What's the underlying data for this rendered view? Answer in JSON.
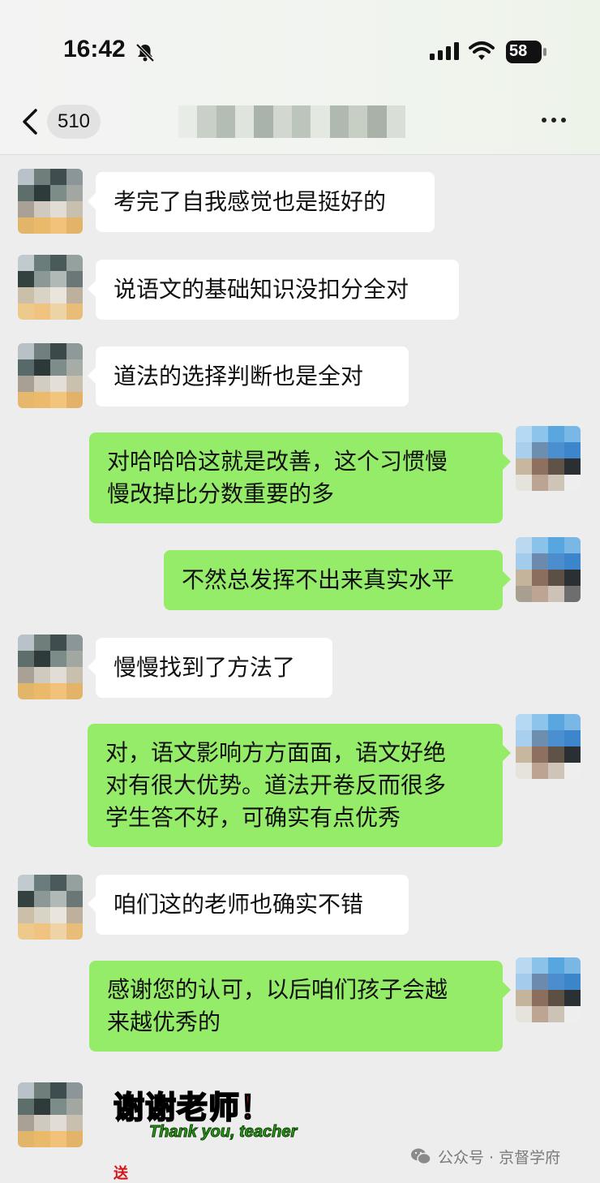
{
  "status": {
    "time": "16:42",
    "battery": "58"
  },
  "nav": {
    "unread": "510"
  },
  "messages": [
    {
      "side": "left",
      "lines": [
        "考完了自我感觉也是挺好的"
      ]
    },
    {
      "side": "left",
      "lines": [
        "说语文的基础知识没扣分全对"
      ]
    },
    {
      "side": "left",
      "lines": [
        "道法的选择判断也是全对"
      ]
    },
    {
      "side": "right",
      "lines": [
        "对哈哈哈这就是改善，这个习惯慢",
        "慢改掉比分数重要的多"
      ]
    },
    {
      "side": "right",
      "lines": [
        "不然总发挥不出来真实水平"
      ]
    },
    {
      "side": "left",
      "lines": [
        "慢慢找到了方法了"
      ]
    },
    {
      "side": "right",
      "lines": [
        "对，语文影响方方面面，语文好绝",
        "对有很大优势。道法开卷反而很多",
        "学生答不好，可确实有点优秀"
      ]
    },
    {
      "side": "left",
      "lines": [
        "咱们这的老师也确实不错"
      ]
    },
    {
      "side": "right",
      "lines": [
        "感谢您的认可，以后咱们孩子会越",
        "来越优秀的"
      ]
    }
  ],
  "sticker": {
    "text_cn": "谢谢老师！",
    "text_en": "Thank you, teacher",
    "tag": "送"
  },
  "watermark": {
    "text": "公众号 · 京督学府"
  },
  "colors": {
    "right_bubble": "#95ec69",
    "left_bubble": "#ffffff",
    "background": "#ededed"
  },
  "icons": [
    "back-chevron-icon",
    "mute-bell-icon",
    "signal-icon",
    "wifi-icon",
    "battery-icon",
    "more-dots-icon",
    "wechat-icon"
  ]
}
